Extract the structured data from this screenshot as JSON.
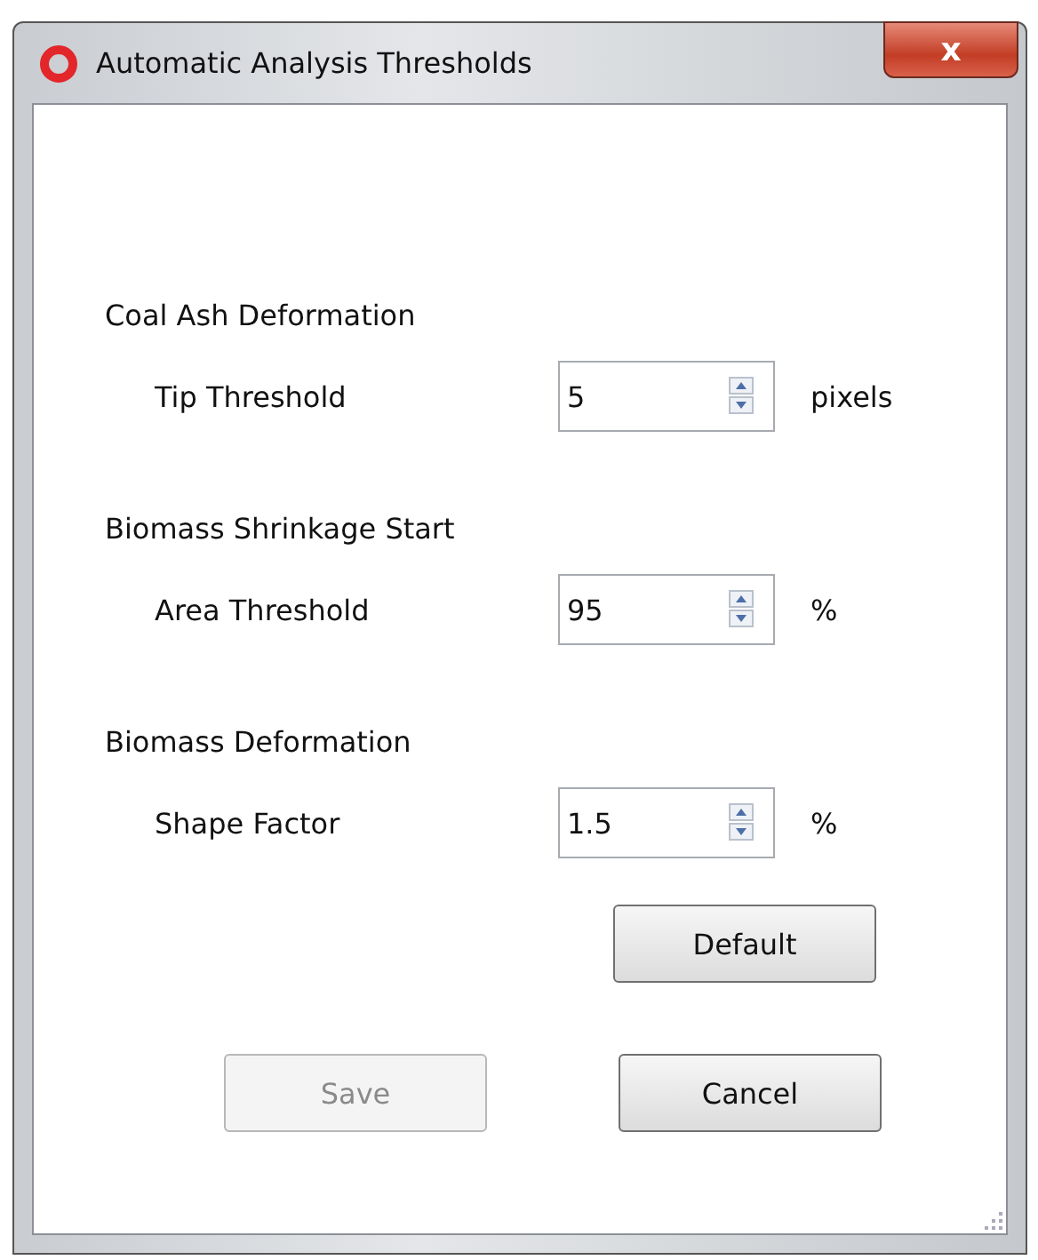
{
  "window": {
    "title": "Automatic Analysis Thresholds",
    "close": "x"
  },
  "sections": [
    {
      "heading": "Coal Ash Deformation",
      "label": "Tip Threshold",
      "value": "5",
      "unit": "pixels"
    },
    {
      "heading": "Biomass Shrinkage Start",
      "label": "Area Threshold",
      "value": "95",
      "unit": "%"
    },
    {
      "heading": "Biomass Deformation",
      "label": "Shape Factor",
      "value": "1.5",
      "unit": "%"
    }
  ],
  "default_button": {
    "label": "Default",
    "disabled": false
  },
  "buttons": [
    {
      "label": "Save",
      "disabled": true
    },
    {
      "label": "Cancel",
      "disabled": false
    }
  ]
}
